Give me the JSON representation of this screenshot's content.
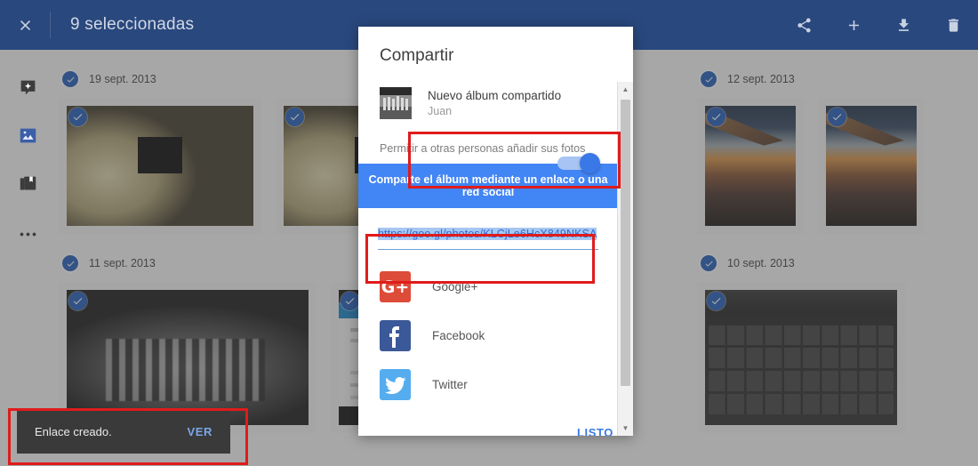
{
  "topbar": {
    "close_icon": "close-icon",
    "title": "9 seleccionadas",
    "actions": [
      {
        "name": "share-icon",
        "label": "Compartir"
      },
      {
        "name": "plus-icon",
        "label": "Añadir"
      },
      {
        "name": "download-icon",
        "label": "Descargar"
      },
      {
        "name": "trash-icon",
        "label": "Eliminar"
      }
    ],
    "bg_color": "#29487d"
  },
  "rail": {
    "items": [
      {
        "name": "assistant-icon",
        "label": "Asistente",
        "selected": false
      },
      {
        "name": "photos-icon",
        "label": "Fotos",
        "selected": true
      },
      {
        "name": "albums-icon",
        "label": "Álbumes",
        "selected": false
      },
      {
        "name": "more-icon",
        "label": "Más",
        "selected": false
      }
    ],
    "accent_color": "#3b5fa8"
  },
  "grid": {
    "sections": [
      {
        "date": "19 sept. 2013",
        "checked": true,
        "photos": [
          {
            "art": "art-sleep",
            "selected": true
          },
          {
            "art": "art-sleep",
            "selected": true
          }
        ]
      },
      {
        "date": "12 sept. 2013",
        "checked": true,
        "photos": [
          {
            "art": "art-wing",
            "selected": true
          },
          {
            "art": "art-wing",
            "selected": true
          }
        ]
      },
      {
        "date": "11 sept. 2013",
        "checked": true,
        "photos": [
          {
            "art": "art-group",
            "selected": true
          },
          {
            "art": "art-screen",
            "selected": true
          }
        ]
      },
      {
        "date": "10 sept. 2013",
        "checked": true,
        "photos": [
          {
            "art": "art-keyb",
            "selected": true
          }
        ]
      }
    ],
    "check_color": "#1a56b4"
  },
  "dialog": {
    "title": "Compartir",
    "album": {
      "name": "Nuevo álbum compartido",
      "owner": "Juan",
      "thumb_name": "album-thumbnail"
    },
    "permission": {
      "label": "Permitir a otras personas añadir sus fotos",
      "enabled": true,
      "on_color": "#3b78e7"
    },
    "banner": "Comparte el álbum mediante un enlace o una red social",
    "banner_color": "#4285f4",
    "link": {
      "url": "https://goo.gl/photos/KLCjLe6HcX849NKSA",
      "selected": true
    },
    "social": [
      {
        "name": "google-plus-icon",
        "label": "Google+",
        "glyph": "G+",
        "color": "#dd4b39"
      },
      {
        "name": "facebook-icon",
        "label": "Facebook",
        "glyph": "f",
        "color": "#3b5998"
      },
      {
        "name": "twitter-icon",
        "label": "Twitter",
        "glyph": "t",
        "color": "#55acee"
      }
    ],
    "done_label": "LISTO",
    "scrollbar": {
      "up": "▲",
      "down": "▼"
    }
  },
  "toast": {
    "message": "Enlace creado.",
    "action": "VER",
    "action_color": "#7aa7e8"
  },
  "annotations": {
    "color": "#e01b1b",
    "boxes": [
      {
        "name": "annotation-permission-toggle"
      },
      {
        "name": "annotation-share-link"
      },
      {
        "name": "annotation-toast"
      }
    ]
  }
}
